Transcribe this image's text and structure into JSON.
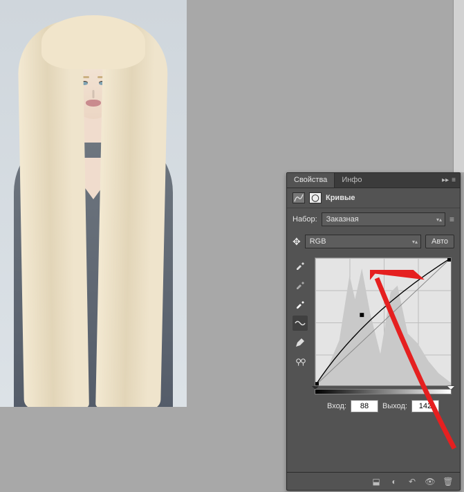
{
  "tabs": {
    "properties": "Свойства",
    "info": "Инфо"
  },
  "header": {
    "title": "Кривые"
  },
  "preset": {
    "label": "Набор:",
    "value": "Заказная"
  },
  "channel": {
    "value": "RGB",
    "auto": "Авто"
  },
  "io": {
    "input_label": "Вход:",
    "input_value": "88",
    "output_label": "Выход:",
    "output_value": "142"
  },
  "chart_data": {
    "type": "line",
    "title": "Кривые",
    "x": [
      0,
      88,
      255
    ],
    "y": [
      0,
      142,
      255
    ],
    "xlabel": "Вход",
    "ylabel": "Выход",
    "xlim": [
      0,
      255
    ],
    "ylim": [
      0,
      255
    ],
    "histogram_peaks": [
      {
        "x": 70,
        "h": 0.95
      },
      {
        "x": 90,
        "h": 0.7
      },
      {
        "x": 150,
        "h": 0.8
      },
      {
        "x": 200,
        "h": 0.4
      }
    ]
  },
  "colors": {
    "accent_red": "#e52020",
    "panel_bg": "#535353"
  }
}
